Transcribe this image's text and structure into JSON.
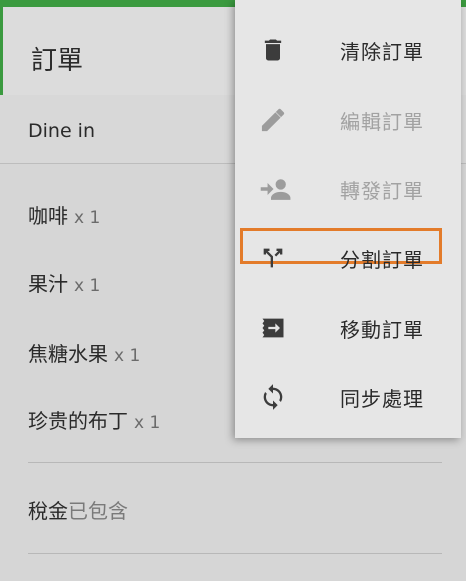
{
  "header": {
    "title": "訂單"
  },
  "order": {
    "mode": "Dine in",
    "items": [
      {
        "name": "咖啡",
        "qty": "x 1"
      },
      {
        "name": "果汁",
        "qty": "x 1"
      },
      {
        "name": "焦糖水果",
        "qty": "x 1"
      },
      {
        "name": "珍贵的布丁",
        "qty": "x 1"
      }
    ],
    "tax_label": "稅金",
    "tax_status": "已包含"
  },
  "menu": {
    "items": [
      {
        "label": "清除訂單",
        "icon": "trash-icon",
        "enabled": true
      },
      {
        "label": "編輯訂單",
        "icon": "pencil-icon",
        "enabled": false
      },
      {
        "label": "轉發訂單",
        "icon": "forward-user-icon",
        "enabled": false
      },
      {
        "label": "分割訂單",
        "icon": "split-icon",
        "enabled": true,
        "highlighted": true
      },
      {
        "label": "移動訂單",
        "icon": "move-ticket-icon",
        "enabled": true
      },
      {
        "label": "同步處理",
        "icon": "sync-icon",
        "enabled": true
      }
    ]
  },
  "colors": {
    "accent": "#3b9a3f",
    "highlight": "#e37b2a"
  }
}
